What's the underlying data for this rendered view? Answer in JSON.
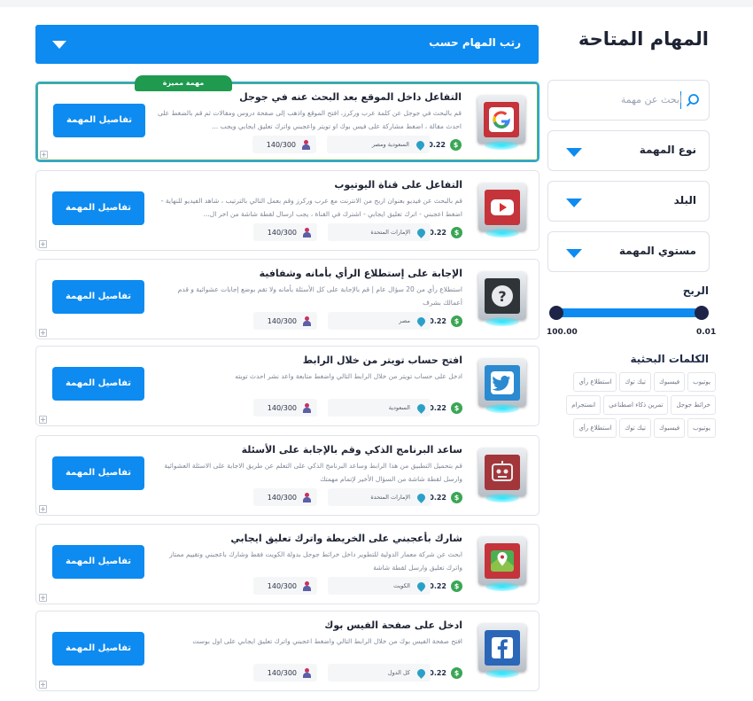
{
  "page_title": "المهام المتاحة",
  "sort": {
    "label": "رتب المهام حسب"
  },
  "search": {
    "placeholder": "ابحث عن مهمة"
  },
  "filters": [
    {
      "label": "نوع المهمة"
    },
    {
      "label": "البلد"
    },
    {
      "label": "مستوي المهمة"
    }
  ],
  "profit": {
    "title": "الربح",
    "min": "0.01",
    "max": "100.00"
  },
  "keywords": {
    "title": "الكلمات البحثية",
    "tags": [
      "يوتيوب",
      "فيسبوك",
      "تيك توك",
      "استطلاع رأي",
      "خرائط جوجل",
      "تمرين ذكاء اصطناعي",
      "انستجرام",
      "يوتيوب",
      "فيسبوك",
      "تيك توك",
      "استطلاع رأي"
    ]
  },
  "featured_badge": "مهمة مميزة",
  "details_button_label": "تفاصيل المهمة",
  "colors": {
    "accent": "#0d8bf0",
    "featured_badge": "#1f9a4f",
    "coin": "#3aa655"
  },
  "tasks": [
    {
      "icon": "google-icon",
      "title": "التفاعل داخل الموقع بعد البحث عنه في جوجل",
      "description": "قم بالبحث في جوجل عن كلمة عرب وركرز، افتح الموقع واذهب إلى صفحة دروس ومقالات ثم قم بالضغط على احدث مقالة ، اضغط مشاركة على فيس بوك او تويتر واعجبني واترك تعليق ايجابي ويجب ...",
      "price": "0.22",
      "country": "السعودية ومصر",
      "slots": "140/300",
      "featured": true
    },
    {
      "icon": "youtube-icon",
      "title": "التفاعل على قناة اليوتيوب",
      "description": "قم بالبحث عن فيديو بعنوان اربح من الانترنت مع عرب وركرز وقم بعمل التالي بالترتيب ، شاهد الفيديو للنهاية - اضغط اعجبني - اترك تعليق ايجابي - اشترك في القناة ، يجب ارسال لقطة شاشة من اخر ال...",
      "price": "0.22",
      "country": "الإمارات المتحدة",
      "slots": "140/300"
    },
    {
      "icon": "survey-icon",
      "title": "الإجابة على إستطلاع الرأي بأمانه وشفافية",
      "description": "استطلاع رأي من 20 سؤال عام | قم بالإجابة على كل الأسئلة بأمانه ولا تقم بوضع إجابات عشوائية و قدم أعمالك بشرف",
      "price": "0.22",
      "country": "مصر",
      "slots": "140/300"
    },
    {
      "icon": "twitter-icon",
      "title": "افتح حساب تويتر من خلال الرابط",
      "description": "ادخل على حساب تويتر من خلال الرابط التالي واضغط متابعة واعد نشر احدث تويته",
      "price": "0.22",
      "country": "السعودية",
      "slots": "140/300"
    },
    {
      "icon": "ai-robot-icon",
      "title": "ساعد البرنامج الذكي وقم بالإجابة على الأسئلة",
      "description": "قم بتحميل التطبيق من هذا الرابط وساعد البرنامج الذكي على التعلم عن طريق الاجابة على الاسئلة العشوائية وارسل لقطة شاشة من السؤال الأخير لإتمام مهمتك",
      "price": "0.22",
      "country": "الإمارات المتحدة",
      "slots": "140/300"
    },
    {
      "icon": "map-icon",
      "title": "شارك بأعجبني على الخريطة واترك تعليق ايجابي",
      "description": "ابحث عن شركة معمار الدولية للتطوير داخل خرائط جوجل بدولة الكويت فقط وشارك باعجبني وتقييم ممتاز واترك تعليق وارسل لقطة شاشة",
      "price": "0.22",
      "country": "الكويت",
      "slots": "140/300"
    },
    {
      "icon": "facebook-icon",
      "title": "ادخل على صفحة الفيس بوك",
      "description": "افتح صفحة الفيس بوك من خلال الرابط التالي واضغط اعجبني واترك تعليق ايجابي على اول بوست",
      "price": "0.22",
      "country": "كل الدول",
      "slots": "140/300"
    }
  ]
}
